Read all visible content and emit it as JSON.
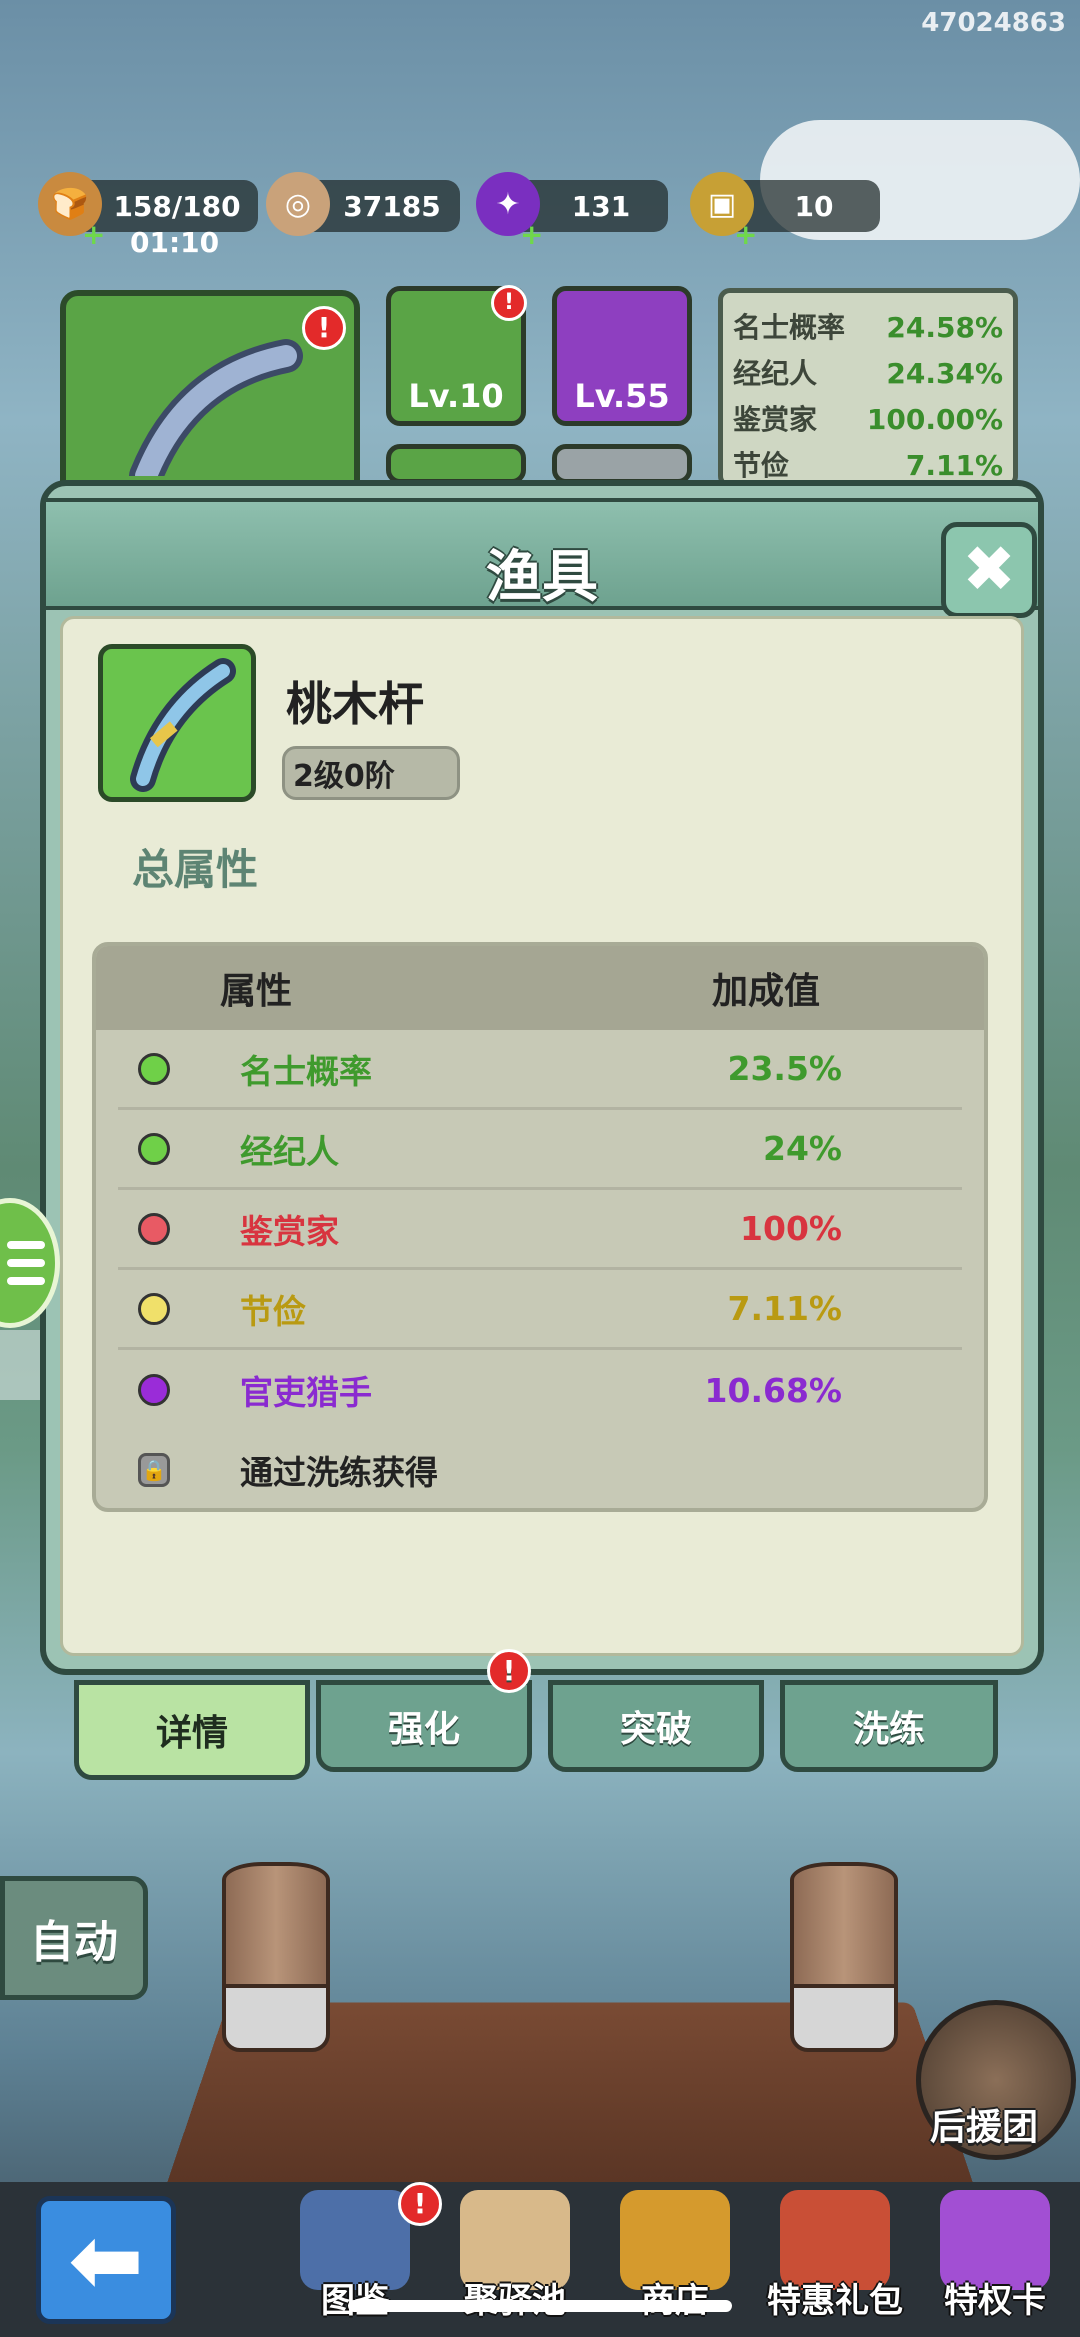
{
  "game_id": "47024863",
  "resources": {
    "stamina": {
      "value": "158/180",
      "timer": "01:10",
      "icon": "bread-icon"
    },
    "coins": {
      "value": "37185",
      "icon": "coin-icon"
    },
    "gems": {
      "value": "131",
      "icon": "purple-gem-icon"
    },
    "tickets": {
      "value": "10",
      "icon": "ticket-icon"
    }
  },
  "equipment_strip": {
    "line_level": "Lv.10",
    "bait_level": "Lv.55"
  },
  "stat_panel": [
    {
      "name": "名士概率",
      "value": "24.58%"
    },
    {
      "name": "经纪人",
      "value": "24.34%"
    },
    {
      "name": "鉴赏家",
      "value": "100.00%"
    },
    {
      "name": "节俭",
      "value": "7.11%"
    }
  ],
  "modal": {
    "title": "渔具",
    "close_label": "✖",
    "item": {
      "name": "桃木杆",
      "level": "2级0阶"
    },
    "section_title": "总属性",
    "table": {
      "header_attr": "属性",
      "header_value": "加成值",
      "rows": [
        {
          "name": "名士概率",
          "value": "23.5%",
          "color": "#6fd048",
          "text_color": "#3f9a2d"
        },
        {
          "name": "经纪人",
          "value": "24%",
          "color": "#6fd048",
          "text_color": "#3f9a2d"
        },
        {
          "name": "鉴赏家",
          "value": "100%",
          "color": "#e85a64",
          "text_color": "#d8343f"
        },
        {
          "name": "节俭",
          "value": "7.11%",
          "color": "#f0e06a",
          "text_color": "#b99a12"
        },
        {
          "name": "官吏猎手",
          "value": "10.68%",
          "color": "#9a2cd8",
          "text_color": "#8a2ad0"
        }
      ],
      "locked_row": "通过洗练获得"
    }
  },
  "tabs": [
    {
      "label": "详情",
      "active": true
    },
    {
      "label": "强化",
      "alert": true
    },
    {
      "label": "突破"
    },
    {
      "label": "洗练"
    }
  ],
  "auto_label": "自动",
  "support_label": "后援团",
  "nav": [
    {
      "label": "图鉴",
      "icon": "book-icon"
    },
    {
      "label": "聚驿池",
      "icon": "map-icon"
    },
    {
      "label": "商店",
      "icon": "shop-icon"
    },
    {
      "label": "特惠礼包",
      "icon": "gift-icon"
    },
    {
      "label": "特权卡",
      "icon": "privilege-card-icon"
    }
  ],
  "colors": {
    "accent_green": "#6fbf4a",
    "panel_teal": "#6ea28f",
    "alert_red": "#e32a2a"
  }
}
